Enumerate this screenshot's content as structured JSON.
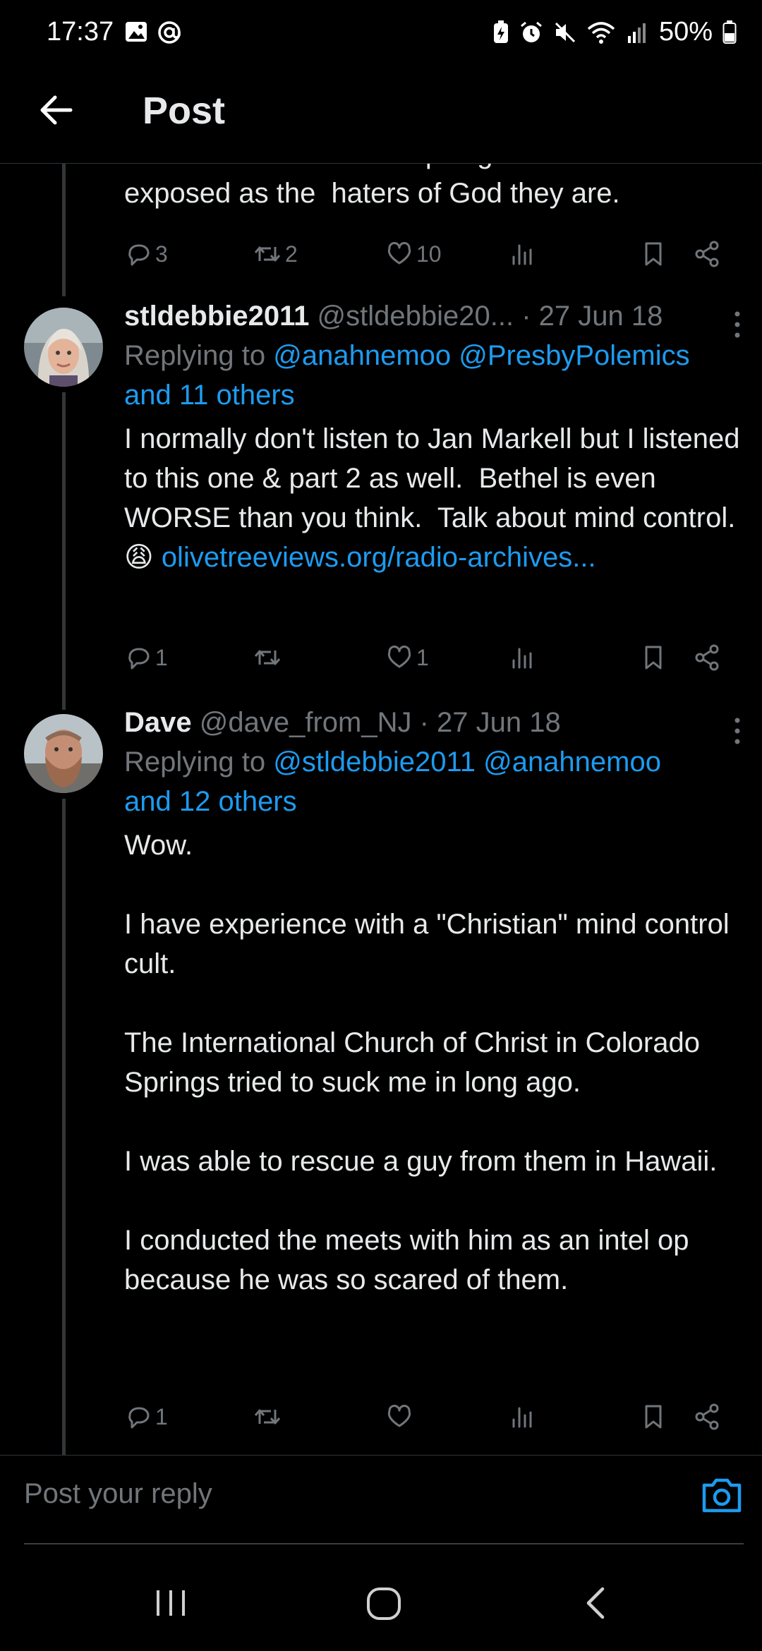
{
  "status_bar": {
    "time": "17:37",
    "battery": "50%",
    "left_icons": [
      "gallery-icon",
      "at-icon"
    ],
    "right_icons": [
      "battery-saver-icon",
      "alarm-icon",
      "mute-icon",
      "wifi-icon",
      "signal-icon",
      "battery-icon"
    ]
  },
  "header": {
    "title": "Post",
    "back_icon": "back-arrow-icon"
  },
  "tweets": [
    {
      "body": "exposed as the  haters of God they are.",
      "clipped_top_line": "leaders to fall from the spotlight and be",
      "counts": {
        "replies": "3",
        "reposts": "2",
        "likes": "10",
        "views": ""
      }
    },
    {
      "name": "stldebbie2011",
      "handle": "@stldebbie20...",
      "date": "· 27 Jun 18",
      "replying_prefix": "Replying to ",
      "replying_to": "@anahnemoo @PresbyPolemics",
      "replying_others": "and 11 others",
      "body": "I normally don't listen to Jan Markell but I listened to this one & part 2 as well.  Bethel is even WORSE than you think.  Talk about mind control.  😩 ",
      "link_text": "olivetreeviews.org/radio-archives...",
      "counts": {
        "replies": "1",
        "reposts": "",
        "likes": "1",
        "views": ""
      }
    },
    {
      "name": "Dave",
      "handle": "@dave_from_NJ",
      "date": "· 27 Jun 18",
      "replying_prefix": "Replying to ",
      "replying_to": "@stldebbie2011 @anahnemoo",
      "replying_others": "and 12 others",
      "body": "Wow.\n\nI have experience with a \"Christian\" mind control cult.\n\nThe International Church of Christ in Colorado Springs tried to suck me in long ago.\n\nI was able to rescue a guy from them in Hawaii.\n\nI conducted the meets with him as an intel op because he was so scared of them.",
      "counts": {
        "replies": "1",
        "reposts": "",
        "likes": "",
        "views": ""
      }
    }
  ],
  "reply_bar": {
    "placeholder": "Post your reply",
    "camera_icon": "camera-icon"
  },
  "nav_bar": {
    "icons": [
      "recent-apps-icon",
      "home-icon",
      "back-icon"
    ]
  },
  "colors": {
    "background": "#000000",
    "text": "#e7e9ea",
    "muted": "#71767b",
    "link": "#1d9bf0",
    "divider": "#2f3336"
  }
}
